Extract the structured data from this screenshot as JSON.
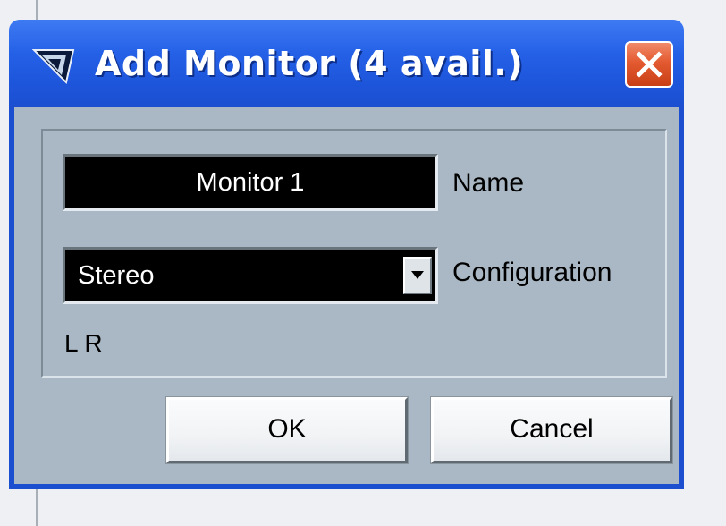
{
  "dialog": {
    "title": "Add Monitor (4 avail.)",
    "icon": "cubase-app-icon",
    "close_icon": "close-icon"
  },
  "form": {
    "name_value": "Monitor 1",
    "name_label": "Name",
    "configuration_value": "Stereo",
    "configuration_label": "Configuration",
    "channels": "L R"
  },
  "buttons": {
    "ok_label": "OK",
    "cancel_label": "Cancel"
  },
  "colors": {
    "titlebar": "#2460e6",
    "close": "#e45a30",
    "client": "#a9b8c4",
    "field_bg": "#000000"
  }
}
